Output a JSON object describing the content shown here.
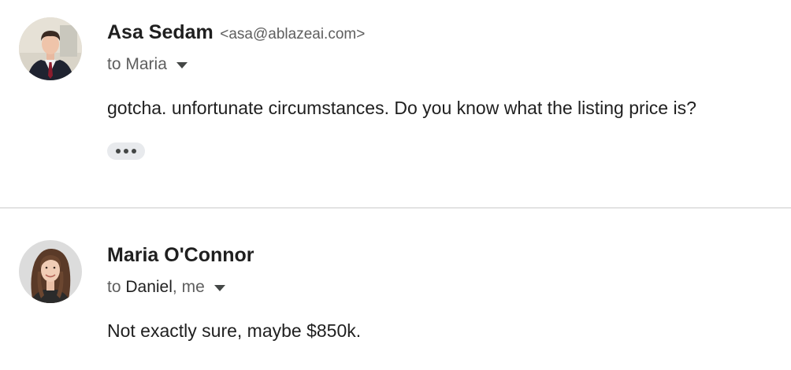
{
  "messages": [
    {
      "sender_name": "Asa Sedam",
      "sender_email": "<asa@ablazeai.com>",
      "to_prefix": "to ",
      "to_names": "Maria",
      "to_suffix": "",
      "body": "gotcha. unfortunate circumstances. Do you know what the listing price is?",
      "avatar_icon": "man-in-suit-photo",
      "trimmed_content_icon": "ellipsis-icon"
    },
    {
      "sender_name": "Maria O'Connor",
      "sender_email": "",
      "to_prefix": "to ",
      "to_names": "Daniel",
      "to_suffix": ", me",
      "body": "Not exactly sure, maybe $850k.",
      "avatar_icon": "woman-smiling-photo"
    }
  ],
  "colors": {
    "primary_text": "#1f1f1f",
    "secondary_text": "#5e5e5e",
    "divider": "#e3e3e3",
    "chip_bg": "#e8eaed"
  }
}
